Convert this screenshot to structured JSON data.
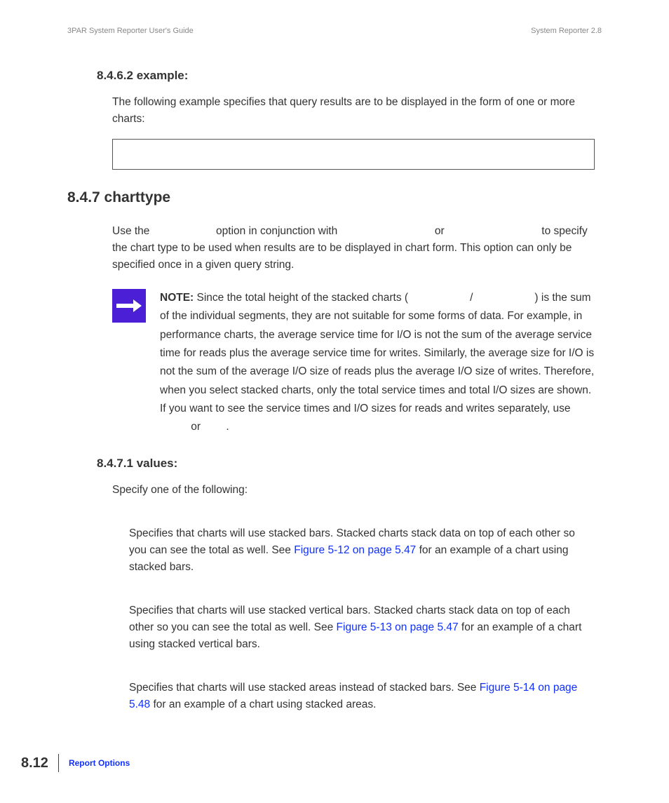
{
  "header": {
    "left": "3PAR System Reporter User's Guide",
    "right": "System Reporter 2.8"
  },
  "sec8462": {
    "heading": "8.4.6.2 example:",
    "para": "The following example specifies that query results are to be displayed in the form of one or more charts:"
  },
  "sec847": {
    "heading": "8.4.7 charttype",
    "para_1a": "Use the ",
    "para_1b": " option in conjunction with ",
    "para_1c": " or ",
    "para_1d": " to specify the chart type to be used when results are to be displayed in chart form. This option can only be specified once in a given query string."
  },
  "note": {
    "label": "NOTE:",
    "body_a": " Since the total height of the stacked charts (",
    "body_b": "/",
    "body_c": ") is the sum of the individual segments, they are not suitable for some forms of data. For example, in performance charts, the average service time for I/O is not the sum of the average service time for reads plus the average service time for writes. Similarly, the average size for I/O is not the sum of the average I/O size of reads plus the average I/O size of writes. Therefore, when you select stacked charts, only the total service times and total I/O sizes are shown. If you want to see the service times and I/O sizes for reads and writes separately, use ",
    "body_d": " or ",
    "body_e": "."
  },
  "sec8471": {
    "heading": "8.4.7.1 values:",
    "intro": "Specify one of the following:"
  },
  "values": {
    "v1_a": "Specifies that charts will use stacked bars. Stacked charts stack data on top of each other so you can see the total as well. See ",
    "v1_link": "Figure 5-12 on page 5.47",
    "v1_b": " for an example of a chart using stacked bars.",
    "v2_a": "Specifies that charts will use stacked vertical bars. Stacked charts stack data on top of each other so you can see the total as well. See ",
    "v2_link": "Figure 5-13 on page 5.47",
    "v2_b": " for an example of a chart using stacked vertical bars.",
    "v3_a": "Specifies that charts will use stacked areas instead of stacked bars. See ",
    "v3_link": "Figure 5-14 on page 5.48",
    "v3_b": " for an example of a chart using stacked areas."
  },
  "footer": {
    "page": "8.12",
    "label": "Report Options"
  }
}
